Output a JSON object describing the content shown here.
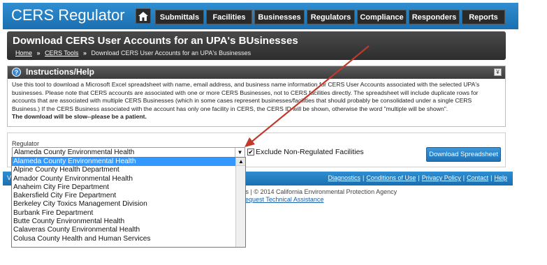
{
  "header": {
    "app_title": "CERS Regulator",
    "nav": [
      "Submittals",
      "Facilities",
      "Businesses",
      "Regulators",
      "Compliance",
      "Responders",
      "Reports"
    ]
  },
  "page": {
    "title": "Download CERS User Accounts for an UPA's BUsinesses",
    "breadcrumb": [
      "Home",
      "CERS Tools",
      "Download CERS User Accounts for an UPA's Businesses"
    ],
    "breadcrumb_sep": "»"
  },
  "instructions": {
    "title": "Instructions/Help",
    "info_glyph": "?",
    "collapse_glyph": "¥",
    "body": "Use this tool to download a Microsoft Excel spreadsheet with name, email address, and business name information for CERS User Accounts associated with the selected UPA's businesses. Please note that CERS accounts are associated with one or more CERS Businesses, not to CERS facilities directly. The spreadsheet will include duplicate rows for accounts that are associated with multiple CERS Businesses (which in some cases represent businesses/facilities that should probably be consolidated under a single CERS Business.) If the CERS Business associated with the account has only one facility in CERS, the CERS ID will be shown, otherwise the word \"multiple will be shown\".",
    "warning": "The download will be slow--please be a patient."
  },
  "form": {
    "regulator_label": "Regulator",
    "selected": "Alameda County Environmental Health",
    "exclude_label": "Exclude Non-Regulated Facilities",
    "exclude_checked": "✔",
    "download_label": "Download Spreadsheet",
    "options": [
      "Alameda County Environmental Health",
      "Alpine County Health Department",
      "Amador County Environmental Health",
      "Anaheim City Fire Department",
      "Bakersfield City Fire Department",
      "Berkeley City Toxics Management Division",
      "Burbank Fire Department",
      "Butte County Environmental Health",
      "Calaveras County Environmental Health",
      "Colusa County Health and Human Services"
    ]
  },
  "footer": {
    "links": [
      "Diagnostics",
      "Conditions of Use",
      "Privacy Policy",
      "Contact",
      "Help"
    ],
    "copyright": "ness | © 2014 California Environmental Protection Agency",
    "support_prefix": "t:",
    "support_link": "Request Technical Assistance",
    "left_stub": "V"
  },
  "colors": {
    "header_blue": "#1f7cc2",
    "dark_bar": "#333333",
    "selected_option": "#3399ff",
    "arrow": "#c0392b"
  }
}
